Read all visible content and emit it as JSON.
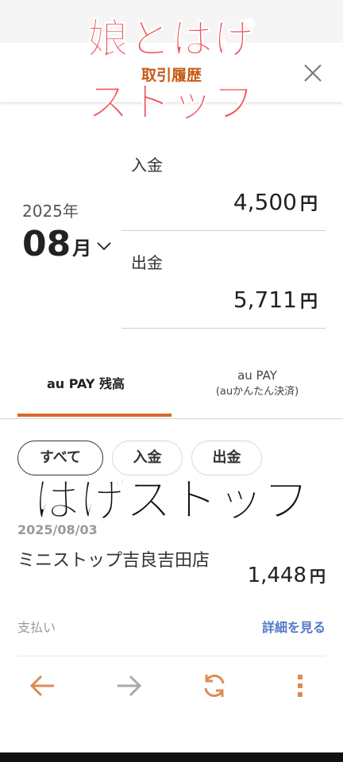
{
  "header": {
    "title": "取引履歴"
  },
  "overlay": {
    "line1": "娘とはげ",
    "line2": "ストップ",
    "big": "はげストップ"
  },
  "period": {
    "year": "2025年",
    "month": "08",
    "month_unit": "月"
  },
  "summary": {
    "income_label": "入金",
    "income_amount": "4,500",
    "income_unit": "円",
    "expense_label": "出金",
    "expense_amount": "5,711",
    "expense_unit": "円"
  },
  "tabs": {
    "tab1": "au PAY 残高",
    "tab2": "au PAY",
    "tab2_sub": "(auかんたん決済)"
  },
  "filters": {
    "all": "すべて",
    "income": "入金",
    "expense": "出金"
  },
  "transactions": [
    {
      "date": "2025/08/03",
      "name": "ミニストップ吉良吉田店",
      "amount": "1,448",
      "unit": "円",
      "type": "支払い",
      "detail": "詳細を見る"
    }
  ],
  "colors": {
    "accent": "#d8692a",
    "overlay_red": "#f0505a",
    "link": "#5378c8"
  },
  "toolbar": {
    "icons": [
      "back-arrow-icon",
      "forward-arrow-icon",
      "refresh-icon",
      "more-vertical-icon"
    ]
  }
}
